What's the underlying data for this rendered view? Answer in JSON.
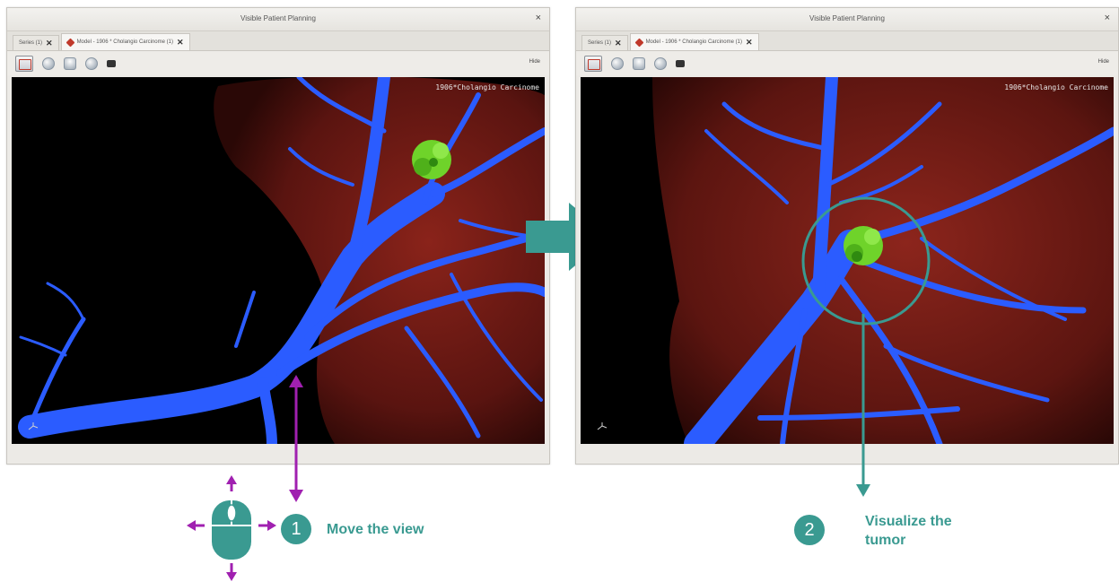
{
  "app": {
    "window_title": "Visible Patient Planning",
    "close_glyph": "×"
  },
  "windows": [
    {
      "tabs": [
        {
          "label": "Series (1)",
          "close": "✕"
        },
        {
          "label": "Model - 1906 * Cholangio Carcinome (1)",
          "close": "✕"
        }
      ],
      "hide_label": "Hide",
      "view_label": "1906*Cholangio Carcinome"
    },
    {
      "tabs": [
        {
          "label": "Series (1)",
          "close": "✕"
        },
        {
          "label": "Model - 1906 * Cholangio Carcinome (1)",
          "close": "✕"
        }
      ],
      "hide_label": "Hide",
      "view_label": "1906*Cholangio Carcinome"
    }
  ],
  "steps": [
    {
      "number": "1",
      "label": "Move the view"
    },
    {
      "number": "2",
      "label_line1": "Visualize the",
      "label_line2": "tumor"
    }
  ],
  "colors": {
    "accent": "#3a9a91",
    "magenta": "#a020b0",
    "vessel": "#2b5cff",
    "liver": "#6a1a14",
    "tumor": "#6fd32a"
  },
  "icons": [
    "close-icon",
    "model-icon",
    "view-reset-icon",
    "sphere-icon",
    "person-icon",
    "camera-icon",
    "orientation-icon",
    "mouse-icon",
    "arrow-right-icon"
  ]
}
